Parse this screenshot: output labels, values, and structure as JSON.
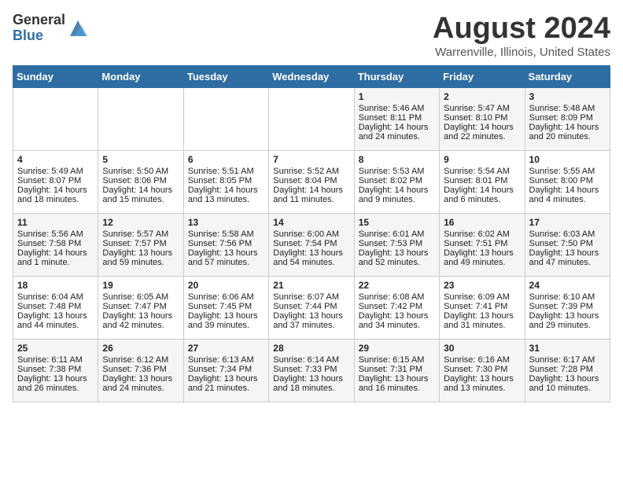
{
  "header": {
    "logo_general": "General",
    "logo_blue": "Blue",
    "month_title": "August 2024",
    "location": "Warrenville, Illinois, United States"
  },
  "days_of_week": [
    "Sunday",
    "Monday",
    "Tuesday",
    "Wednesday",
    "Thursday",
    "Friday",
    "Saturday"
  ],
  "weeks": [
    [
      {
        "day": "",
        "info": ""
      },
      {
        "day": "",
        "info": ""
      },
      {
        "day": "",
        "info": ""
      },
      {
        "day": "",
        "info": ""
      },
      {
        "day": "1",
        "info": "Sunrise: 5:46 AM\nSunset: 8:11 PM\nDaylight: 14 hours\nand 24 minutes."
      },
      {
        "day": "2",
        "info": "Sunrise: 5:47 AM\nSunset: 8:10 PM\nDaylight: 14 hours\nand 22 minutes."
      },
      {
        "day": "3",
        "info": "Sunrise: 5:48 AM\nSunset: 8:09 PM\nDaylight: 14 hours\nand 20 minutes."
      }
    ],
    [
      {
        "day": "4",
        "info": "Sunrise: 5:49 AM\nSunset: 8:07 PM\nDaylight: 14 hours\nand 18 minutes."
      },
      {
        "day": "5",
        "info": "Sunrise: 5:50 AM\nSunset: 8:06 PM\nDaylight: 14 hours\nand 15 minutes."
      },
      {
        "day": "6",
        "info": "Sunrise: 5:51 AM\nSunset: 8:05 PM\nDaylight: 14 hours\nand 13 minutes."
      },
      {
        "day": "7",
        "info": "Sunrise: 5:52 AM\nSunset: 8:04 PM\nDaylight: 14 hours\nand 11 minutes."
      },
      {
        "day": "8",
        "info": "Sunrise: 5:53 AM\nSunset: 8:02 PM\nDaylight: 14 hours\nand 9 minutes."
      },
      {
        "day": "9",
        "info": "Sunrise: 5:54 AM\nSunset: 8:01 PM\nDaylight: 14 hours\nand 6 minutes."
      },
      {
        "day": "10",
        "info": "Sunrise: 5:55 AM\nSunset: 8:00 PM\nDaylight: 14 hours\nand 4 minutes."
      }
    ],
    [
      {
        "day": "11",
        "info": "Sunrise: 5:56 AM\nSunset: 7:58 PM\nDaylight: 14 hours\nand 1 minute."
      },
      {
        "day": "12",
        "info": "Sunrise: 5:57 AM\nSunset: 7:57 PM\nDaylight: 13 hours\nand 59 minutes."
      },
      {
        "day": "13",
        "info": "Sunrise: 5:58 AM\nSunset: 7:56 PM\nDaylight: 13 hours\nand 57 minutes."
      },
      {
        "day": "14",
        "info": "Sunrise: 6:00 AM\nSunset: 7:54 PM\nDaylight: 13 hours\nand 54 minutes."
      },
      {
        "day": "15",
        "info": "Sunrise: 6:01 AM\nSunset: 7:53 PM\nDaylight: 13 hours\nand 52 minutes."
      },
      {
        "day": "16",
        "info": "Sunrise: 6:02 AM\nSunset: 7:51 PM\nDaylight: 13 hours\nand 49 minutes."
      },
      {
        "day": "17",
        "info": "Sunrise: 6:03 AM\nSunset: 7:50 PM\nDaylight: 13 hours\nand 47 minutes."
      }
    ],
    [
      {
        "day": "18",
        "info": "Sunrise: 6:04 AM\nSunset: 7:48 PM\nDaylight: 13 hours\nand 44 minutes."
      },
      {
        "day": "19",
        "info": "Sunrise: 6:05 AM\nSunset: 7:47 PM\nDaylight: 13 hours\nand 42 minutes."
      },
      {
        "day": "20",
        "info": "Sunrise: 6:06 AM\nSunset: 7:45 PM\nDaylight: 13 hours\nand 39 minutes."
      },
      {
        "day": "21",
        "info": "Sunrise: 6:07 AM\nSunset: 7:44 PM\nDaylight: 13 hours\nand 37 minutes."
      },
      {
        "day": "22",
        "info": "Sunrise: 6:08 AM\nSunset: 7:42 PM\nDaylight: 13 hours\nand 34 minutes."
      },
      {
        "day": "23",
        "info": "Sunrise: 6:09 AM\nSunset: 7:41 PM\nDaylight: 13 hours\nand 31 minutes."
      },
      {
        "day": "24",
        "info": "Sunrise: 6:10 AM\nSunset: 7:39 PM\nDaylight: 13 hours\nand 29 minutes."
      }
    ],
    [
      {
        "day": "25",
        "info": "Sunrise: 6:11 AM\nSunset: 7:38 PM\nDaylight: 13 hours\nand 26 minutes."
      },
      {
        "day": "26",
        "info": "Sunrise: 6:12 AM\nSunset: 7:36 PM\nDaylight: 13 hours\nand 24 minutes."
      },
      {
        "day": "27",
        "info": "Sunrise: 6:13 AM\nSunset: 7:34 PM\nDaylight: 13 hours\nand 21 minutes."
      },
      {
        "day": "28",
        "info": "Sunrise: 6:14 AM\nSunset: 7:33 PM\nDaylight: 13 hours\nand 18 minutes."
      },
      {
        "day": "29",
        "info": "Sunrise: 6:15 AM\nSunset: 7:31 PM\nDaylight: 13 hours\nand 16 minutes."
      },
      {
        "day": "30",
        "info": "Sunrise: 6:16 AM\nSunset: 7:30 PM\nDaylight: 13 hours\nand 13 minutes."
      },
      {
        "day": "31",
        "info": "Sunrise: 6:17 AM\nSunset: 7:28 PM\nDaylight: 13 hours\nand 10 minutes."
      }
    ]
  ]
}
